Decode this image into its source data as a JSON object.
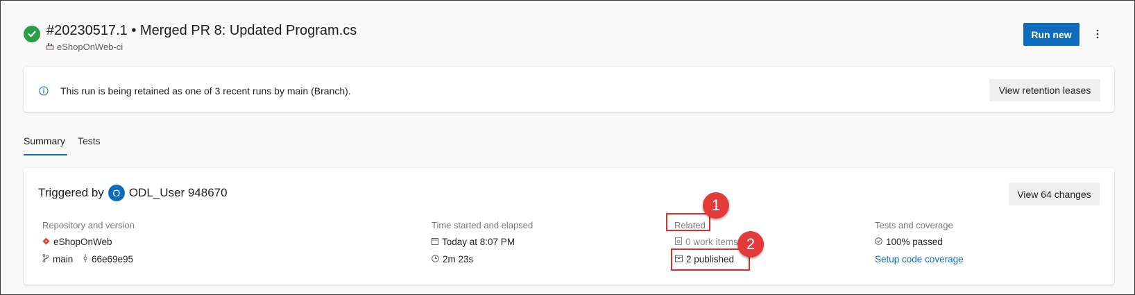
{
  "header": {
    "run_title": "#20230517.1 • Merged PR 8: Updated Program.cs",
    "pipeline_name": "eShopOnWeb-ci",
    "run_new_label": "Run new"
  },
  "banner": {
    "message": "This run is being retained as one of 3 recent runs by main (Branch).",
    "view_retention_label": "View retention leases"
  },
  "tabs": [
    {
      "label": "Summary",
      "selected": true
    },
    {
      "label": "Tests",
      "selected": false
    }
  ],
  "summary": {
    "triggered_by_label": "Triggered by",
    "avatar_initial": "O",
    "user_name": "ODL_User 948670",
    "view_changes_label": "View 64 changes",
    "repository": {
      "label": "Repository and version",
      "repo_name": "eShopOnWeb",
      "branch": "main",
      "commit": "66e69e95"
    },
    "time": {
      "label": "Time started and elapsed",
      "started": "Today at 8:07 PM",
      "elapsed": "2m 23s"
    },
    "related": {
      "label": "Related",
      "work_items": "0 work items",
      "published": "2 published"
    },
    "tests": {
      "label": "Tests and coverage",
      "passed": "100% passed",
      "setup_coverage_label": "Setup code coverage"
    }
  },
  "callouts": [
    "1",
    "2"
  ],
  "colors": {
    "accent": "#0f6cbd",
    "success": "#2a9d44",
    "callout": "#e53a3a"
  }
}
